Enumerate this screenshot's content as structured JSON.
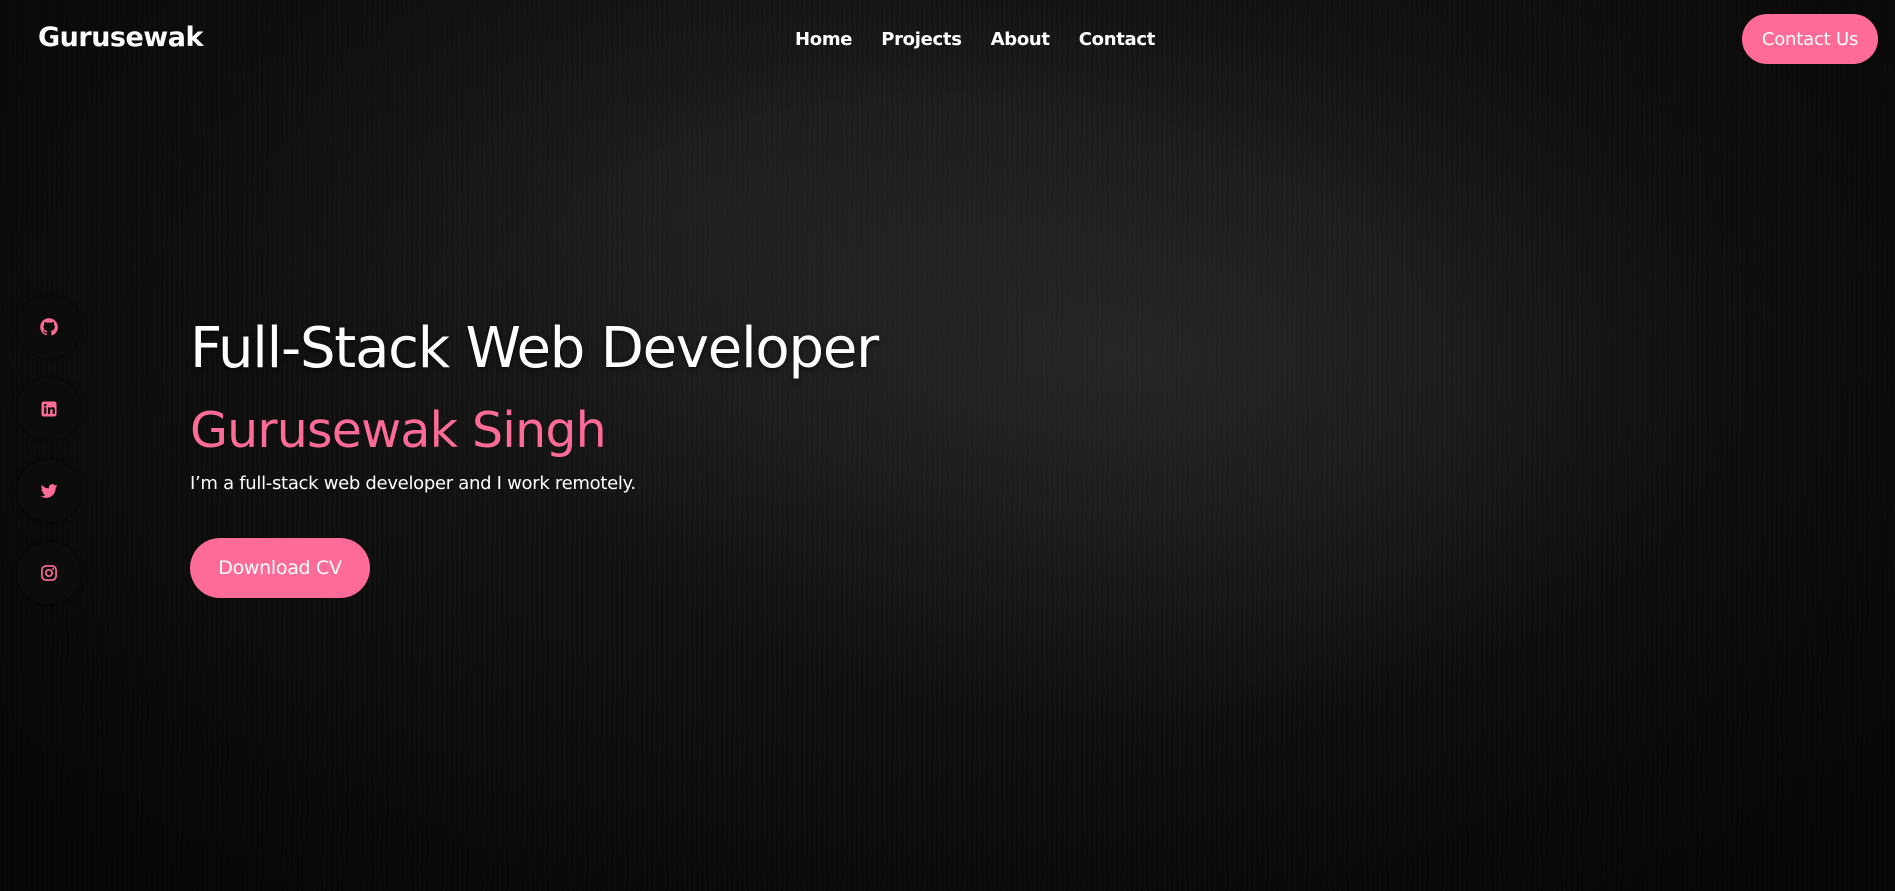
{
  "header": {
    "brand": "Gurusewak",
    "nav": [
      {
        "label": "Home"
      },
      {
        "label": "Projects"
      },
      {
        "label": "About"
      },
      {
        "label": "Contact"
      }
    ],
    "cta_label": "Contact Us"
  },
  "social": [
    {
      "icon": "github-icon"
    },
    {
      "icon": "linkedin-icon"
    },
    {
      "icon": "twitter-icon"
    },
    {
      "icon": "instagram-icon"
    }
  ],
  "hero": {
    "title": "Full-Stack Web Developer",
    "name": "Gurusewak Singh",
    "description": "I’m a full-stack web developer and I work remotely.",
    "button_label": "Download CV"
  },
  "colors": {
    "accent": "#ff6b97",
    "background": "#111111",
    "text": "#ffffff"
  }
}
